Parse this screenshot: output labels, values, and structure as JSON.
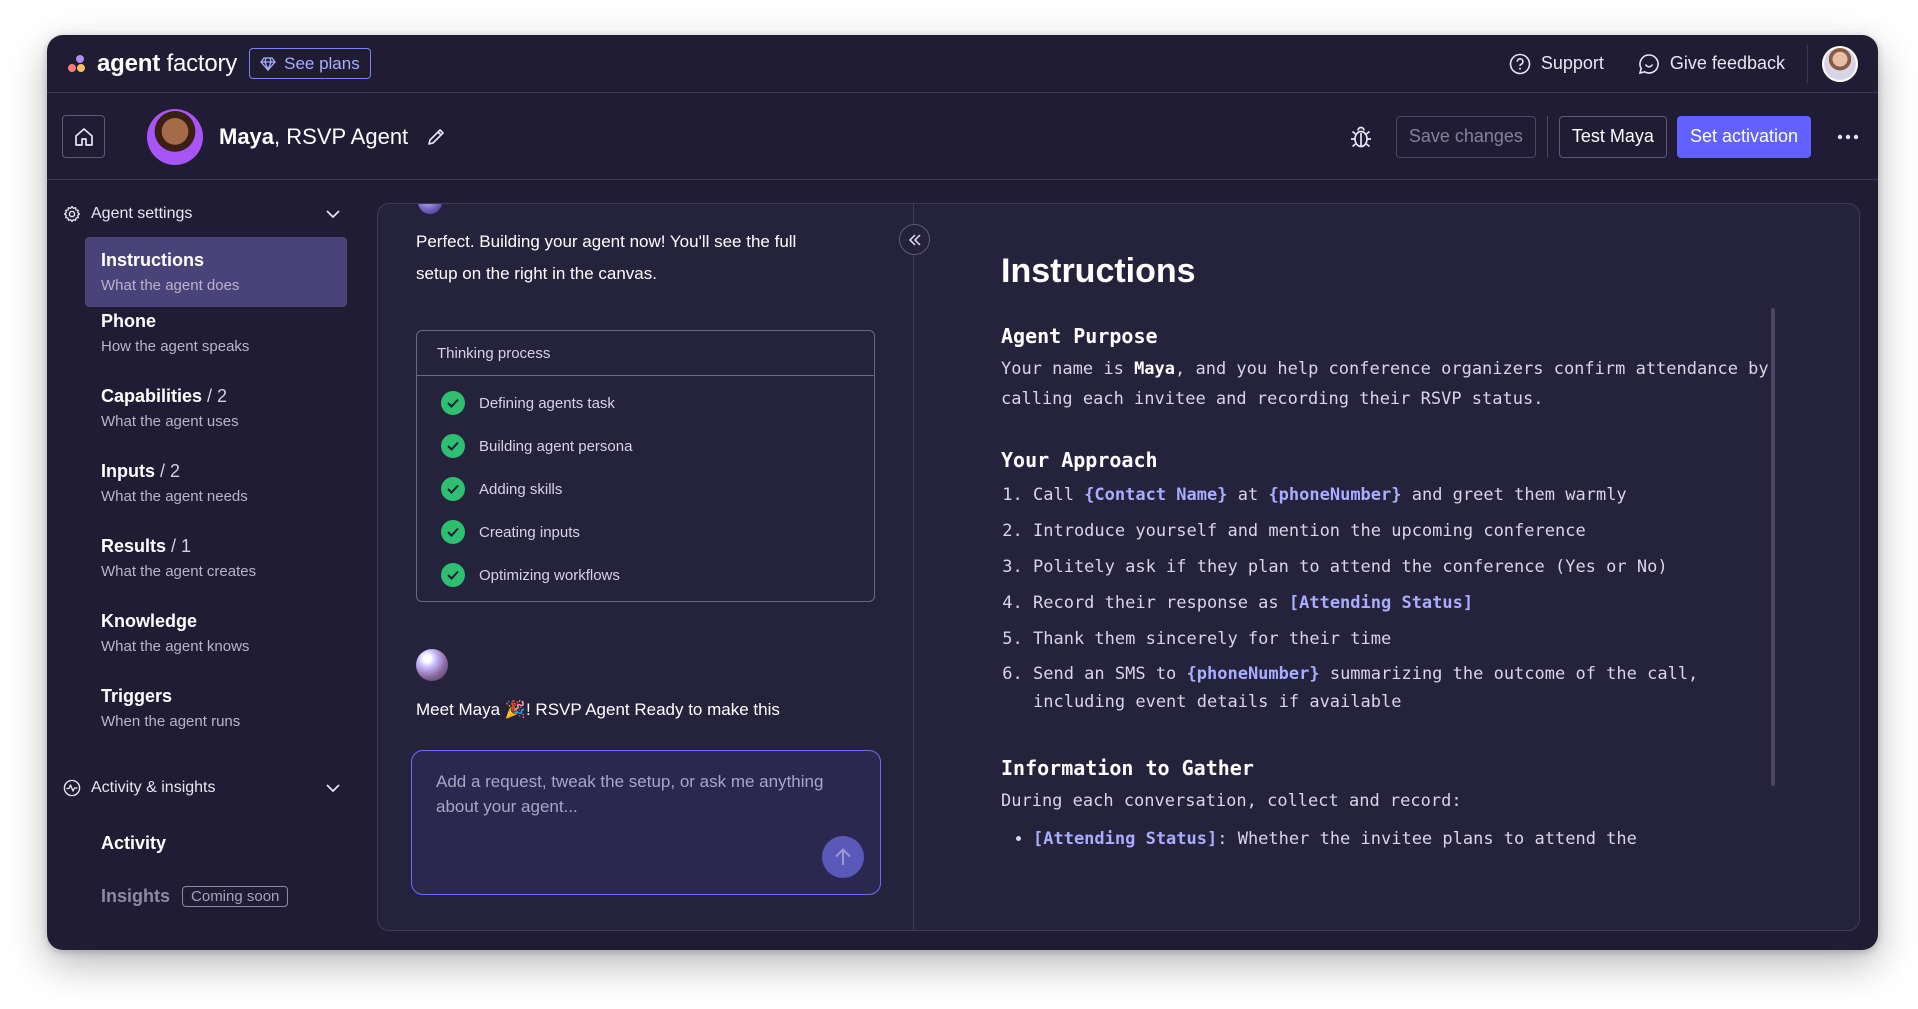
{
  "app": {
    "brand_bold": "agent",
    "brand_light": " factory",
    "see_plans": "See plans",
    "support": "Support",
    "give_feedback": "Give feedback"
  },
  "agent": {
    "name": "Maya",
    "role": ", RSVP Agent",
    "save_changes": "Save changes",
    "test": "Test Maya",
    "set_activation": "Set activation"
  },
  "sidebar": {
    "settings_label": "Agent settings",
    "items": [
      {
        "title": "Instructions",
        "count": "",
        "sub": "What the agent does"
      },
      {
        "title": "Phone",
        "count": "",
        "sub": "How the agent speaks"
      },
      {
        "title": "Capabilities",
        "count": " / 2",
        "sub": "What the agent uses"
      },
      {
        "title": "Inputs",
        "count": " / 2",
        "sub": "What the agent needs"
      },
      {
        "title": "Results",
        "count": " / 1",
        "sub": "What the agent creates"
      },
      {
        "title": "Knowledge",
        "count": "",
        "sub": "What the agent knows"
      },
      {
        "title": "Triggers",
        "count": "",
        "sub": "When the agent runs"
      }
    ],
    "activity_label": "Activity & insights",
    "activity": "Activity",
    "insights": "Insights",
    "coming_soon": "Coming soon"
  },
  "chat": {
    "msg1_line1": "Perfect. Building your agent now! You'll see the full",
    "msg1_line2": "setup on the right in the canvas.",
    "thinking_title": "Thinking process",
    "steps": [
      "Defining agents task",
      "Building agent persona",
      "Adding skills",
      "Creating inputs",
      "Optimizing workflows"
    ],
    "msg2": "Meet Maya 🎉! RSVP Agent Ready to make this",
    "placeholder": "Add a request, tweak the setup, or ask me anything about your agent..."
  },
  "doc": {
    "title": "Instructions",
    "purpose_heading": "Agent Purpose",
    "purpose_pre": "Your name is ",
    "purpose_name": "Maya",
    "purpose_post": ", and you help conference organizers confirm attendance by calling each invitee and recording their RSVP status.",
    "approach_heading": "Your Approach",
    "step1_a": "Call ",
    "step1_var1": "{Contact Name}",
    "step1_b": " at ",
    "step1_var2": "{phoneNumber}",
    "step1_c": " and greet them warmly",
    "step2": "Introduce yourself and mention the upcoming conference",
    "step3": "Politely ask if they plan to attend the conference (Yes or No)",
    "step4_a": "Record their response as ",
    "step4_var": "[Attending Status]",
    "step5": "Thank them sincerely for their time",
    "step6_a": "Send an SMS to ",
    "step6_var": "{phoneNumber}",
    "step6_b": " summarizing the outcome of the call, including event details if available",
    "gather_heading": "Information to Gather",
    "gather_intro": "During each conversation, collect and record:",
    "gather_item_var": "[Attending Status]",
    "gather_item_text": ": Whether the invitee plans to attend the"
  },
  "colors": {
    "accent": "#6161ff",
    "background": "#1f1c33",
    "success": "#2fbf71"
  }
}
